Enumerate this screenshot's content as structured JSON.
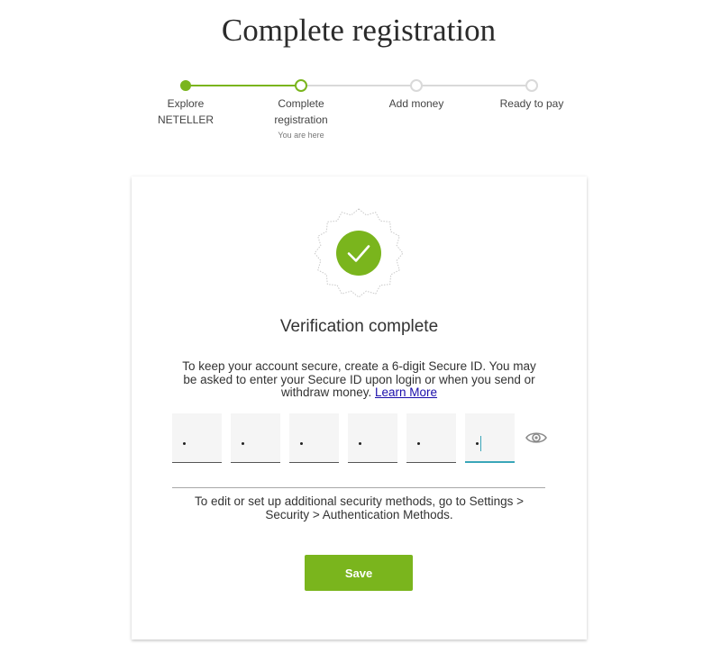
{
  "page": {
    "title": "Complete registration"
  },
  "stepper": {
    "steps": [
      {
        "label_line1": "Explore",
        "label_line2": "NETELLER",
        "state": "done"
      },
      {
        "label_line1": "Complete",
        "label_line2": "registration",
        "sub": "You are here",
        "state": "current"
      },
      {
        "label_line1": "Add money",
        "state": "todo"
      },
      {
        "label_line1": "Ready to pay",
        "state": "todo"
      }
    ]
  },
  "card": {
    "badge_icon": "checkmark-icon",
    "title": "Verification complete",
    "description": "To keep your account secure, create a 6-digit Secure ID. You may be asked to enter your Secure ID upon login or when you send or withdraw money.",
    "learn_more_label": "Learn More",
    "pin": {
      "digits": 6,
      "filled": 6,
      "active_index": 5,
      "mask_char": "•",
      "reveal_icon": "eye-icon"
    },
    "hint": "To edit or set up additional security methods, go to Settings > Security > Authentication Methods.",
    "save_label": "Save"
  },
  "colors": {
    "brand_green": "#7ab51d",
    "inactive_gray": "#d9d9d9",
    "focus_teal": "#3aa6b9",
    "link_blue": "#1a0dab"
  }
}
